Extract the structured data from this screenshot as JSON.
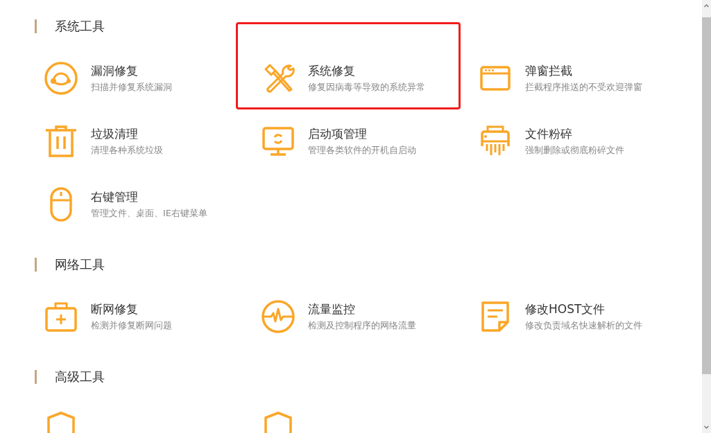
{
  "sections": [
    {
      "title": "系统工具",
      "items": [
        {
          "kind": "headset",
          "title": "漏洞修复",
          "desc": "扫描并修复系统漏洞",
          "highlighted": false
        },
        {
          "kind": "tools",
          "title": "系统修复",
          "desc": "修复因病毒等导致的系统异常",
          "highlighted": true
        },
        {
          "kind": "window",
          "title": "弹窗拦截",
          "desc": "拦截程序推送的不受欢迎弹窗",
          "highlighted": false
        },
        {
          "kind": "trash",
          "title": "垃圾清理",
          "desc": "清理各种系统垃圾",
          "highlighted": false
        },
        {
          "kind": "monitor",
          "title": "启动项管理",
          "desc": "管理各类软件的开机自启动",
          "highlighted": false
        },
        {
          "kind": "shredder",
          "title": "文件粉碎",
          "desc": "强制删除或彻底粉碎文件",
          "highlighted": false
        },
        {
          "kind": "mouse",
          "title": "右键管理",
          "desc": "管理文件、桌面、IE右键菜单",
          "highlighted": false
        }
      ]
    },
    {
      "title": "网络工具",
      "items": [
        {
          "kind": "kit",
          "title": "断网修复",
          "desc": "检测并修复断网问题",
          "highlighted": false
        },
        {
          "kind": "pulse",
          "title": "流量监控",
          "desc": "检测及控制程序的网络流量",
          "highlighted": false
        },
        {
          "kind": "note",
          "title": "修改HOST文件",
          "desc": "修改负责域名快速解析的文件",
          "highlighted": false
        }
      ]
    },
    {
      "title": "高级工具",
      "items": [
        {
          "kind": "shield",
          "highlighted": false
        },
        {
          "kind": "shield",
          "highlighted": false
        }
      ]
    }
  ]
}
